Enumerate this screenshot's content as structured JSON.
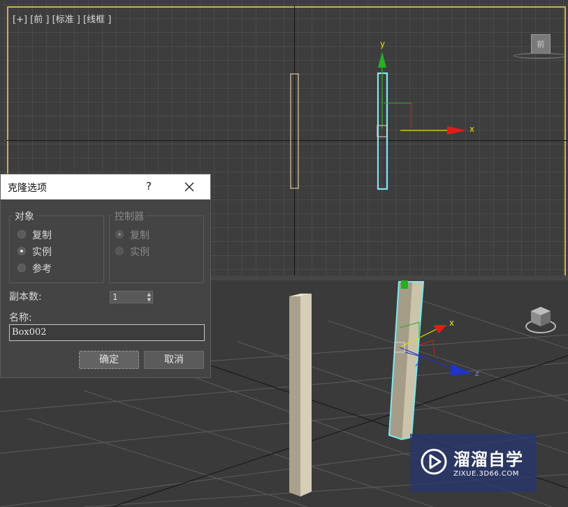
{
  "front_viewport": {
    "label": "[+] [前 ] [标准 ] [线框 ]",
    "viewcube_face": "前",
    "gizmo_x": "x",
    "gizmo_y": "y"
  },
  "perspective_viewport": {
    "gizmo_x": "x",
    "gizmo_z": "z"
  },
  "dialog": {
    "title": "克隆选项",
    "help": "?",
    "object_group": {
      "title": "对象",
      "options": [
        "复制",
        "实例",
        "参考"
      ],
      "selected": "实例"
    },
    "controller_group": {
      "title": "控制器",
      "options": [
        "复制",
        "实例"
      ],
      "selected": "复制",
      "disabled": true
    },
    "copies_label": "副本数:",
    "copies_value": "1",
    "name_label": "名称:",
    "name_value": "Box002",
    "ok_label": "确定",
    "cancel_label": "取消"
  },
  "watermark": {
    "name": "溜溜自学",
    "url": "ZIXUE.3D66.COM"
  },
  "colors": {
    "grid_border": "#c8b25a",
    "selection": "#7fe6f2",
    "axis_x": "#e21b1b",
    "axis_y": "#23b023",
    "axis_z": "#1f34c8",
    "gizmo_label": "#e8e000"
  }
}
